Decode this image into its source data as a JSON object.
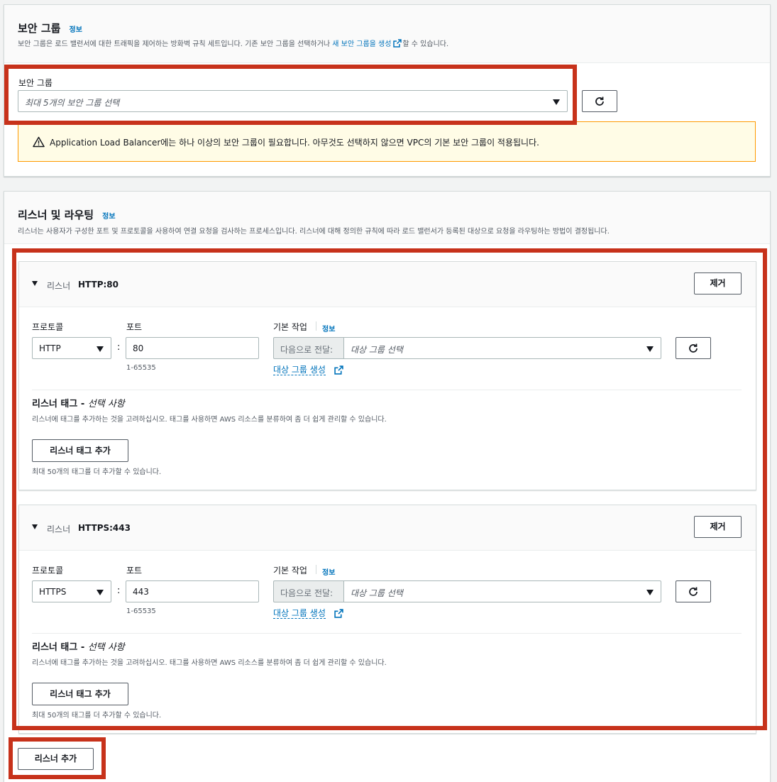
{
  "security": {
    "title": "보안 그룹",
    "info": "정보",
    "desc_before": "보안 그룹은 로드 밸런서에 대한 트래픽을 제어하는 방화벽 규칙 세트입니다. 기존 보안 그룹을 선택하거나 ",
    "desc_link": "새 보안 그룹을 생성",
    "desc_after": "할 수 있습니다.",
    "field_label": "보안 그룹",
    "select_placeholder": "최대 5개의 보안 그룹 선택",
    "warning": "Application Load Balancer에는 하나 이상의 보안 그룹이 필요합니다. 아무것도 선택하지 않으면 VPC의 기본 보안 그룹이 적용됩니다."
  },
  "listeners_section": {
    "title": "리스너 및 라우팅",
    "info": "정보",
    "desc": "리스너는 사용자가 구성한 포트 및 프로토콜을 사용하여 연결 요청을 검사하는 프로세스입니다. 리스너에 대해 정의한 규칙에 따라 로드 밸런서가 등록된 대상으로 요청을 라우팅하는 방법이 결정됩니다.",
    "add_listener": "리스너 추가"
  },
  "listeners": [
    {
      "label": "리스너",
      "name": "HTTP:80",
      "remove": "제거",
      "protocol_label": "프로토콜",
      "protocol": "HTTP",
      "port_label": "포트",
      "port": "80",
      "port_hint": "1-65535",
      "action_label": "기본 작업",
      "action_info": "정보",
      "forward_prefix": "다음으로 전달:",
      "target_placeholder": "대상 그룹 선택",
      "create_tg": "대상 그룹 생성",
      "tags_title": "리스너 태그 - ",
      "tags_optional": "선택 사항",
      "tags_desc": "리스너에 태그를 추가하는 것을 고려하십시오. 태그를 사용하면 AWS 리소스를 분류하여 좀 더 쉽게 관리할 수 있습니다.",
      "add_tag": "리스너 태그 추가",
      "tag_limit": "최대 50개의 태그를 더 추가할 수 있습니다."
    },
    {
      "label": "리스너",
      "name": "HTTPS:443",
      "remove": "제거",
      "protocol_label": "프로토콜",
      "protocol": "HTTPS",
      "port_label": "포트",
      "port": "443",
      "port_hint": "1-65535",
      "action_label": "기본 작업",
      "action_info": "정보",
      "forward_prefix": "다음으로 전달:",
      "target_placeholder": "대상 그룹 선택",
      "create_tg": "대상 그룹 생성",
      "tags_title": "리스너 태그 - ",
      "tags_optional": "선택 사항",
      "tags_desc": "리스너에 태그를 추가하는 것을 고려하십시오. 태그를 사용하면 AWS 리소스를 분류하여 좀 더 쉽게 관리할 수 있습니다.",
      "add_tag": "리스너 태그 추가",
      "tag_limit": "최대 50개의 태그를 더 추가할 수 있습니다."
    }
  ],
  "colors": {
    "link": "#0073bb",
    "highlight": "#c7321b",
    "warning_border": "#ff9900"
  }
}
